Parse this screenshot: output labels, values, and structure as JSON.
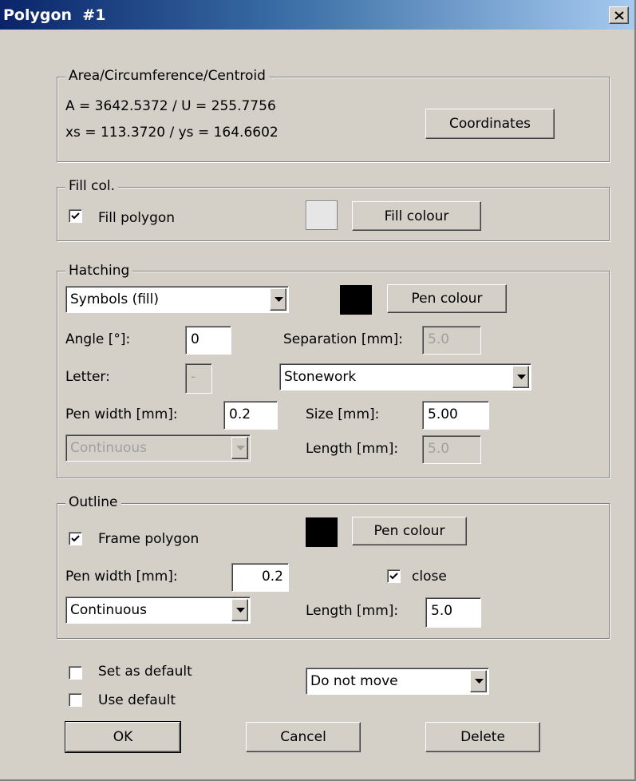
{
  "window": {
    "title": "Polygon  #1"
  },
  "area_group": {
    "legend": "Area/Circumference/Centroid",
    "line1": "A = 3642.5372  /    U = 255.7756",
    "line2": "xs = 113.3720  /    ys = 164.6602",
    "coordinates_button": "Coordinates"
  },
  "fill_group": {
    "legend": "Fill col.",
    "fill_polygon_label": "Fill polygon",
    "fill_polygon_checked": true,
    "fill_colour_button": "Fill colour",
    "fill_swatch_color": "#e6e6e6"
  },
  "hatching_group": {
    "legend": "Hatching",
    "type_value": "Symbols (fill)",
    "pen_swatch_color": "#000000",
    "pen_colour_button": "Pen colour",
    "angle_label": "Angle [°]:",
    "angle_value": "0",
    "separation_label": "Separation [mm]:",
    "separation_value": "5.0",
    "letter_label": "Letter:",
    "letter_value": "-",
    "pattern_value": "Stonework",
    "pen_width_label": "Pen width [mm]:",
    "pen_width_value": "0.2",
    "size_label": "Size [mm]:",
    "size_value": "5.00",
    "line_style_value": "Continuous",
    "length_label": "Length [mm]:",
    "length_value": "5.0"
  },
  "outline_group": {
    "legend": "Outline",
    "frame_polygon_label": "Frame polygon",
    "frame_polygon_checked": true,
    "pen_swatch_color": "#000000",
    "pen_colour_button": "Pen colour",
    "pen_width_label": "Pen width [mm]:",
    "pen_width_value": "0.2",
    "close_label": "close",
    "close_checked": true,
    "line_style_value": "Continuous",
    "length_label": "Length [mm]:",
    "length_value": "5.0"
  },
  "bottom": {
    "set_default_label": "Set as default",
    "set_default_checked": false,
    "use_default_label": "Use default",
    "use_default_checked": false,
    "move_value": "Do not move",
    "ok_button": "OK",
    "cancel_button": "Cancel",
    "delete_button": "Delete"
  }
}
